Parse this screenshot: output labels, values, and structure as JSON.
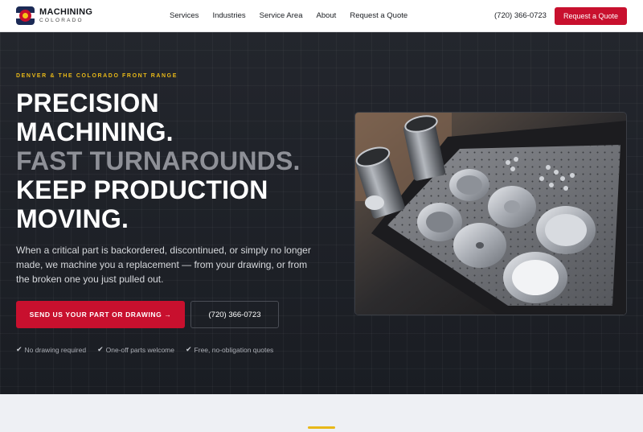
{
  "brand": {
    "name": "MACHINING",
    "sub": "COLORADO"
  },
  "nav": {
    "items": [
      "Services",
      "Industries",
      "Service Area",
      "About",
      "Request a Quote"
    ],
    "phone": "(720) 366-0723",
    "cta": "Request a Quote"
  },
  "hero": {
    "eyebrow": "DENVER & THE COLORADO FRONT RANGE",
    "headline": [
      "PRECISION",
      "MACHINING.",
      "FAST TURNAROUNDS.",
      "KEEP PRODUCTION",
      "MOVING."
    ],
    "lead": "When a critical part is backordered, discontinued, or simply no longer made, we machine you a replacement — from your drawing, or from the broken one you just pulled out.",
    "primary_button": "SEND US YOUR PART OR DRAWING →",
    "phone_button": "(720) 366-0723",
    "perks": [
      "No drawing required",
      "One-off parts welcome",
      "Free, no-obligation quotes"
    ],
    "check_icon": "✔"
  },
  "colors": {
    "accent": "#c8102e",
    "highlight": "#e8b818",
    "dark": "#1c1f25"
  }
}
